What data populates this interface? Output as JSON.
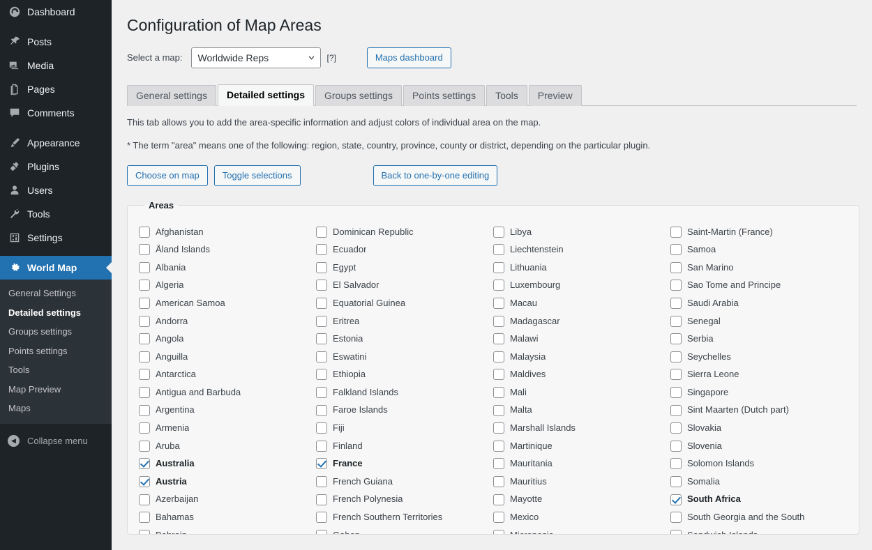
{
  "sidebar": {
    "items": [
      {
        "label": "Dashboard",
        "icon": "dashboard-icon"
      },
      {
        "label": "Posts",
        "icon": "pin-icon"
      },
      {
        "label": "Media",
        "icon": "media-icon"
      },
      {
        "label": "Pages",
        "icon": "pages-icon"
      },
      {
        "label": "Comments",
        "icon": "comments-icon"
      },
      {
        "label": "Appearance",
        "icon": "brush-icon"
      },
      {
        "label": "Plugins",
        "icon": "plug-icon"
      },
      {
        "label": "Users",
        "icon": "user-icon"
      },
      {
        "label": "Tools",
        "icon": "wrench-icon"
      },
      {
        "label": "Settings",
        "icon": "sliders-icon"
      }
    ],
    "current": {
      "label": "World Map",
      "icon": "gear-icon"
    },
    "submenu": [
      {
        "label": "General Settings",
        "current": false
      },
      {
        "label": "Detailed settings",
        "current": true
      },
      {
        "label": "Groups settings",
        "current": false
      },
      {
        "label": "Points settings",
        "current": false
      },
      {
        "label": "Tools",
        "current": false
      },
      {
        "label": "Map Preview",
        "current": false
      },
      {
        "label": "Maps",
        "current": false
      }
    ],
    "collapse_label": "Collapse menu",
    "accent_color": "#2271b1",
    "bg_color": "#1d2327"
  },
  "header": {
    "title": "Configuration of Map Areas",
    "select_label": "Select a map:",
    "select_value": "Worldwide Reps",
    "help_label": "[?]",
    "dashboard_button": "Maps dashboard"
  },
  "tabs": [
    {
      "label": "General settings",
      "active": false
    },
    {
      "label": "Detailed settings",
      "active": true
    },
    {
      "label": "Groups settings",
      "active": false
    },
    {
      "label": "Points settings",
      "active": false
    },
    {
      "label": "Tools",
      "active": false
    },
    {
      "label": "Preview",
      "active": false
    }
  ],
  "descriptions": {
    "line1": "This tab allows you to add the area-specific information and adjust colors of individual area on the map.",
    "line2": "* The term \"area\" means one of the following: region, state, country, province, county or district, depending on the particular plugin."
  },
  "action_buttons": {
    "choose_on_map": "Choose on map",
    "toggle_selections": "Toggle selections",
    "back_to_editing": "Back to one-by-one editing"
  },
  "areas": {
    "legend": "Areas",
    "columns": [
      [
        {
          "label": "Afghanistan",
          "checked": false
        },
        {
          "label": "Åland Islands",
          "checked": false
        },
        {
          "label": "Albania",
          "checked": false
        },
        {
          "label": "Algeria",
          "checked": false
        },
        {
          "label": "American Samoa",
          "checked": false
        },
        {
          "label": "Andorra",
          "checked": false
        },
        {
          "label": "Angola",
          "checked": false
        },
        {
          "label": "Anguilla",
          "checked": false
        },
        {
          "label": "Antarctica",
          "checked": false
        },
        {
          "label": "Antigua and Barbuda",
          "checked": false
        },
        {
          "label": "Argentina",
          "checked": false
        },
        {
          "label": "Armenia",
          "checked": false
        },
        {
          "label": "Aruba",
          "checked": false
        },
        {
          "label": "Australia",
          "checked": true
        },
        {
          "label": "Austria",
          "checked": true
        },
        {
          "label": "Azerbaijan",
          "checked": false
        },
        {
          "label": "Bahamas",
          "checked": false
        },
        {
          "label": "Bahrain",
          "checked": false
        }
      ],
      [
        {
          "label": "Dominican Republic",
          "checked": false
        },
        {
          "label": "Ecuador",
          "checked": false
        },
        {
          "label": "Egypt",
          "checked": false
        },
        {
          "label": "El Salvador",
          "checked": false
        },
        {
          "label": "Equatorial Guinea",
          "checked": false
        },
        {
          "label": "Eritrea",
          "checked": false
        },
        {
          "label": "Estonia",
          "checked": false
        },
        {
          "label": "Eswatini",
          "checked": false
        },
        {
          "label": "Ethiopia",
          "checked": false
        },
        {
          "label": "Falkland Islands",
          "checked": false
        },
        {
          "label": "Faroe Islands",
          "checked": false
        },
        {
          "label": "Fiji",
          "checked": false
        },
        {
          "label": "Finland",
          "checked": false
        },
        {
          "label": "France",
          "checked": true
        },
        {
          "label": "French Guiana",
          "checked": false
        },
        {
          "label": "French Polynesia",
          "checked": false
        },
        {
          "label": "French Southern Territories",
          "checked": false
        },
        {
          "label": "Gabon",
          "checked": false
        }
      ],
      [
        {
          "label": "Libya",
          "checked": false
        },
        {
          "label": "Liechtenstein",
          "checked": false
        },
        {
          "label": "Lithuania",
          "checked": false
        },
        {
          "label": "Luxembourg",
          "checked": false
        },
        {
          "label": "Macau",
          "checked": false
        },
        {
          "label": "Madagascar",
          "checked": false
        },
        {
          "label": "Malawi",
          "checked": false
        },
        {
          "label": "Malaysia",
          "checked": false
        },
        {
          "label": "Maldives",
          "checked": false
        },
        {
          "label": "Mali",
          "checked": false
        },
        {
          "label": "Malta",
          "checked": false
        },
        {
          "label": "Marshall Islands",
          "checked": false
        },
        {
          "label": "Martinique",
          "checked": false
        },
        {
          "label": "Mauritania",
          "checked": false
        },
        {
          "label": "Mauritius",
          "checked": false
        },
        {
          "label": "Mayotte",
          "checked": false
        },
        {
          "label": "Mexico",
          "checked": false
        },
        {
          "label": "Micronesia",
          "checked": false
        }
      ],
      [
        {
          "label": "Saint-Martin (France)",
          "checked": false
        },
        {
          "label": "Samoa",
          "checked": false
        },
        {
          "label": "San Marino",
          "checked": false
        },
        {
          "label": "Sao Tome and Principe",
          "checked": false
        },
        {
          "label": "Saudi Arabia",
          "checked": false
        },
        {
          "label": "Senegal",
          "checked": false
        },
        {
          "label": "Serbia",
          "checked": false
        },
        {
          "label": "Seychelles",
          "checked": false
        },
        {
          "label": "Sierra Leone",
          "checked": false
        },
        {
          "label": "Singapore",
          "checked": false
        },
        {
          "label": "Sint Maarten (Dutch part)",
          "checked": false
        },
        {
          "label": "Slovakia",
          "checked": false
        },
        {
          "label": "Slovenia",
          "checked": false
        },
        {
          "label": "Solomon Islands",
          "checked": false
        },
        {
          "label": "Somalia",
          "checked": false
        },
        {
          "label": "South Africa",
          "checked": true
        },
        {
          "label": "South Georgia and the South",
          "checked": false
        },
        {
          "label": "Sandwich Islands",
          "checked": false
        }
      ]
    ]
  }
}
